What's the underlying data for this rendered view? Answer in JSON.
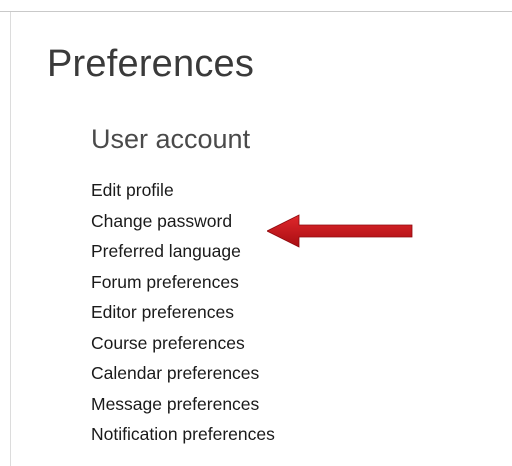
{
  "page": {
    "title": "Preferences"
  },
  "section": {
    "title": "User account",
    "links": [
      "Edit profile",
      "Change password",
      "Preferred language",
      "Forum preferences",
      "Editor preferences",
      "Course preferences",
      "Calendar preferences",
      "Message preferences",
      "Notification preferences"
    ]
  },
  "annotation": {
    "arrow_icon": "red-arrow-left-icon",
    "arrow_color": "#c0121a",
    "points_to": "Change password"
  }
}
